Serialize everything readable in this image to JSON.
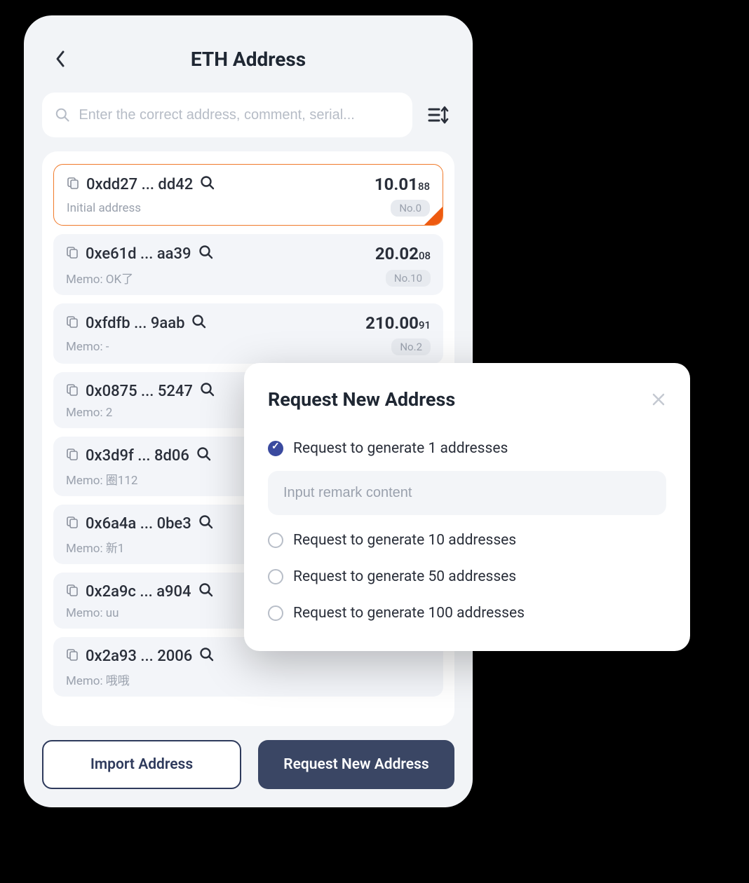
{
  "header": {
    "title": "ETH Address"
  },
  "search": {
    "placeholder": "Enter the correct address, comment, serial..."
  },
  "addresses": [
    {
      "addr": "0xdd27 ... dd42",
      "balance_main": "10.01",
      "balance_sub": "88",
      "memo": "Initial address",
      "badge": "No.0",
      "selected": true
    },
    {
      "addr": "0xe61d ... aa39",
      "balance_main": "20.02",
      "balance_sub": "08",
      "memo": "Memo: OK了",
      "badge": "No.10",
      "selected": false
    },
    {
      "addr": "0xfdfb ... 9aab",
      "balance_main": "210.00",
      "balance_sub": "91",
      "memo": "Memo: -",
      "badge": "No.2",
      "selected": false
    },
    {
      "addr": "0x0875 ... 5247",
      "balance_main": "",
      "balance_sub": "",
      "memo": "Memo: 2",
      "badge": "",
      "selected": false
    },
    {
      "addr": "0x3d9f ... 8d06",
      "balance_main": "",
      "balance_sub": "",
      "memo": "Memo: 圈112",
      "badge": "",
      "selected": false
    },
    {
      "addr": "0x6a4a ... 0be3",
      "balance_main": "",
      "balance_sub": "",
      "memo": "Memo: 新1",
      "badge": "",
      "selected": false
    },
    {
      "addr": "0x2a9c ... a904",
      "balance_main": "",
      "balance_sub": "",
      "memo": "Memo: uu",
      "badge": "",
      "selected": false
    },
    {
      "addr": "0x2a93 ... 2006",
      "balance_main": "",
      "balance_sub": "",
      "memo": "Memo: 哦哦",
      "badge": "",
      "selected": false
    }
  ],
  "footer": {
    "import_label": "Import Address",
    "request_label": "Request New Address"
  },
  "modal": {
    "title": "Request New Address",
    "remark_placeholder": "Input remark content",
    "options": [
      {
        "label": "Request to generate 1 addresses",
        "checked": true
      },
      {
        "label": "Request to generate 10 addresses",
        "checked": false
      },
      {
        "label": "Request to generate 50 addresses",
        "checked": false
      },
      {
        "label": "Request to generate 100 addresses",
        "checked": false
      }
    ]
  }
}
